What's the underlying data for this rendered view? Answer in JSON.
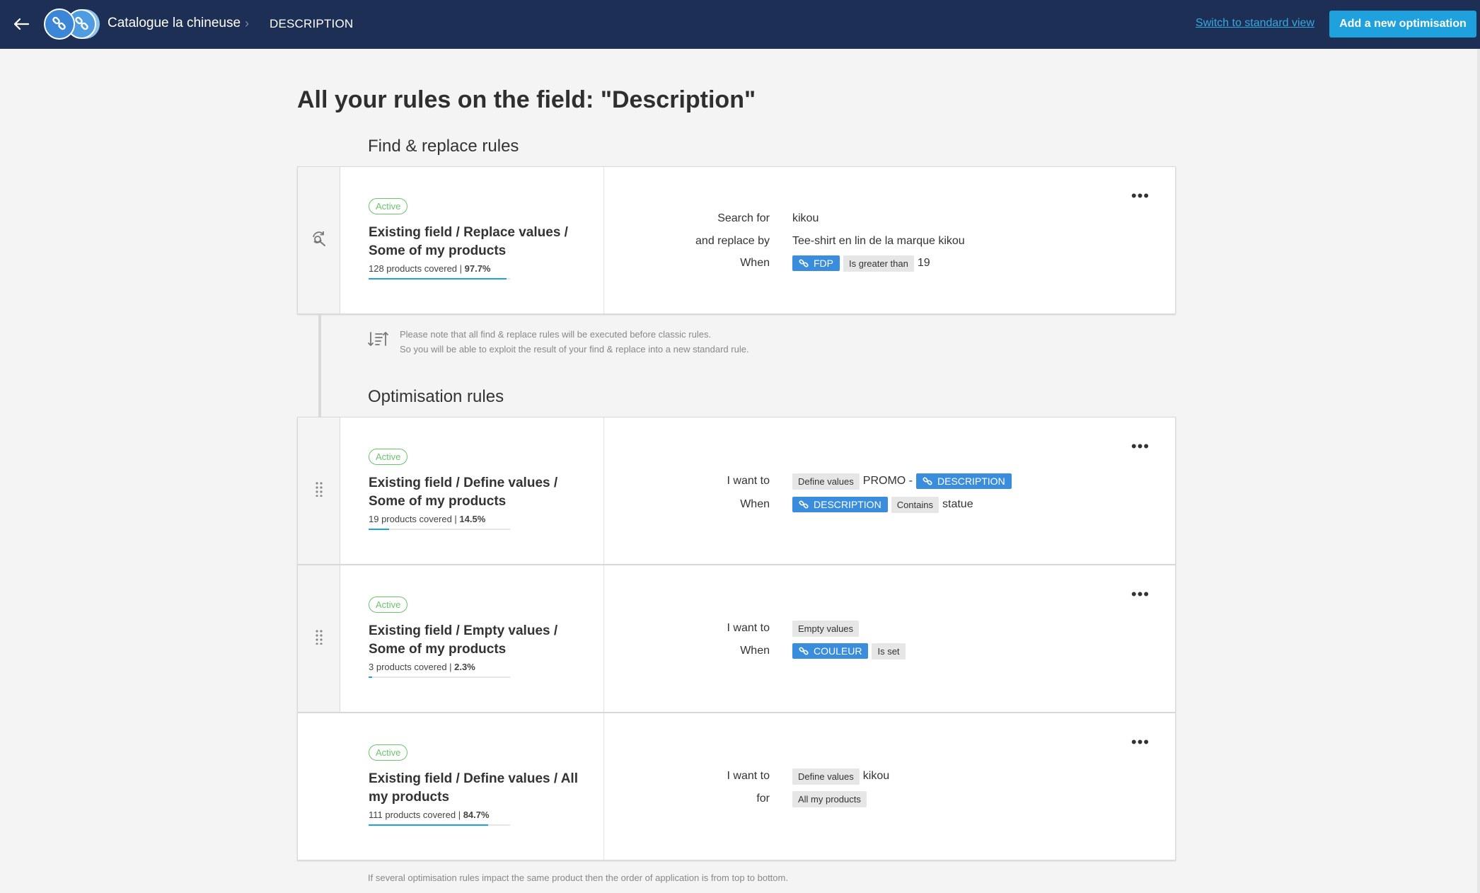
{
  "header": {
    "app_name": "Catalogue la chineuse",
    "breadcrumb_separator": "›",
    "current_page": "DESCRIPTION",
    "switch_view_link": "Switch to standard view",
    "add_button": "Add a new optimisation",
    "background_color": "#1d2f54",
    "accent_color": "#1ea1dc"
  },
  "page_title": "All your rules on the field: \"Description\"",
  "find_replace": {
    "section_title": "Find & replace rules",
    "rules": [
      {
        "status": "Active",
        "title": "Existing field / Replace values / Some of my products",
        "coverage_count": "128 products covered | ",
        "coverage_pct": "97.7%",
        "coverage_fraction": 0.977,
        "conditions": {
          "search_label": "Search for",
          "search_value": "kikou",
          "replace_label": "and replace by",
          "replace_value": "Tee-shirt en lin de la marque kikou",
          "when_label": "When",
          "when_field": "FDP",
          "when_operator": "Is greater than",
          "when_value": "19"
        }
      }
    ]
  },
  "note": {
    "line1": "Please note that all find & replace rules will be executed before classic rules.",
    "line2": "So you will be able to exploit the result of your find & replace into a new standard rule."
  },
  "optimisation": {
    "section_title": "Optimisation rules",
    "rules": [
      {
        "status": "Active",
        "title": "Existing field / Define values / Some of my products",
        "coverage_count": "19 products covered | ",
        "coverage_pct": "14.5%",
        "coverage_fraction": 0.145,
        "i_want_label": "I want to",
        "action": "Define values",
        "action_text": "PROMO -",
        "action_field": "DESCRIPTION",
        "when_label": "When",
        "when_field": "DESCRIPTION",
        "when_operator": "Contains",
        "when_value": "statue"
      },
      {
        "status": "Active",
        "title": "Existing field / Empty values / Some of my products",
        "coverage_count": "3 products covered | ",
        "coverage_pct": "2.3%",
        "coverage_fraction": 0.023,
        "i_want_label": "I want to",
        "action": "Empty values",
        "when_label": "When",
        "when_field": "COULEUR",
        "when_operator": "Is set"
      },
      {
        "status": "Active",
        "title": "Existing field / Define values / All my products",
        "coverage_count": "111 products covered | ",
        "coverage_pct": "84.7%",
        "coverage_fraction": 0.847,
        "i_want_label": "I want to",
        "action": "Define values",
        "action_text": "kikou",
        "for_label": "for",
        "for_value": "All my products"
      }
    ]
  },
  "footer_note": "If several optimisation rules impact the same product then the order of application is from top to bottom."
}
